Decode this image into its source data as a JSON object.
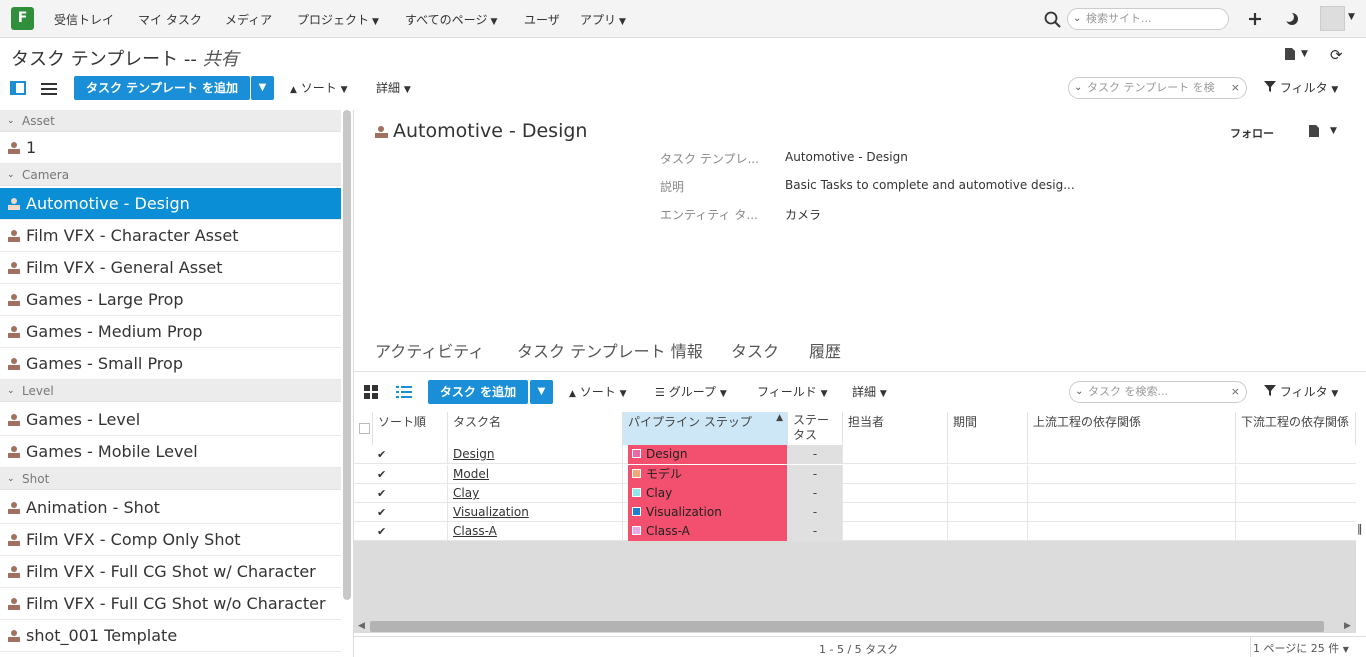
{
  "nav": {
    "logo": "F",
    "inbox": "受信トレイ",
    "my_tasks": "マイ タスク",
    "media": "メディア",
    "projects": "プロジェクト",
    "all_pages": "すべてのページ",
    "users": "ユーザ",
    "apps": "アプリ",
    "search_placeholder": "検索サイト..."
  },
  "page": {
    "title": "タスク テンプレート -- ",
    "title_suffix": "共有",
    "add_template_button": "タスク テンプレート を追加",
    "sort_label": "ソート",
    "detail_label": "詳細",
    "search_placeholder": "タスク テンプレート を検",
    "filter_label": "フィルタ"
  },
  "sidebar": {
    "groups": [
      {
        "label": "Asset",
        "items": [
          "1"
        ]
      },
      {
        "label": "Camera",
        "items": [
          "Automotive - Design",
          "Film VFX - Character Asset",
          "Film VFX - General Asset",
          "Games - Large Prop",
          "Games - Medium Prop",
          "Games - Small Prop"
        ]
      },
      {
        "label": "Level",
        "items": [
          "Games - Level",
          "Games - Mobile Level"
        ]
      },
      {
        "label": "Shot",
        "items": [
          "Animation - Shot",
          "Film VFX - Comp Only Shot",
          "Film VFX - Full CG Shot w/ Character",
          "Film VFX - Full CG Shot w/o Character",
          "shot_001 Template"
        ]
      }
    ],
    "selected": "Automotive - Design"
  },
  "detail": {
    "title": "Automotive - Design",
    "follow": "フォロー",
    "fields": [
      {
        "label": "タスク テンプレ...",
        "value": "Automotive - Design"
      },
      {
        "label": "説明",
        "value": "Basic Tasks to complete and automotive desig..."
      },
      {
        "label": "エンティティ タ...",
        "value": "カメラ"
      }
    ],
    "tabs": [
      "アクティビティ",
      "タスク テンプレート 情報",
      "タスク",
      "履歴"
    ]
  },
  "tasks_toolbar": {
    "add_task_button": "タスク を追加",
    "sort": "ソート",
    "group": "グループ",
    "fields": "フィールド",
    "detail": "詳細",
    "search_placeholder": "タスク を検索...",
    "filter": "フィルタ"
  },
  "grid": {
    "columns": [
      "ソート順",
      "タスク名",
      "パイプライン ステップ",
      "ステータス",
      "担当者",
      "期間",
      "上流工程の依存関係",
      "下流工程の依存関係"
    ],
    "rows": [
      {
        "name": "Design",
        "step": "Design",
        "step_color": "#e86aa6",
        "status": "-"
      },
      {
        "name": "Model",
        "step": "モデル",
        "step_color": "#f0a878",
        "status": "-"
      },
      {
        "name": "Clay",
        "step": "Clay",
        "step_color": "#8fe8e8",
        "status": "-"
      },
      {
        "name": "Visualization",
        "step": "Visualization",
        "step_color": "#1a7fd0",
        "status": "-"
      },
      {
        "name": "Class-A",
        "step": "Class-A",
        "step_color": "#e8a8e0",
        "status": "-"
      }
    ],
    "footer_count": "1 - 5 / 5 タスク",
    "per_page": "1 ページに 25 件"
  },
  "colors": {
    "accent": "#1a8fd8",
    "selected_row": "#0a8ed6",
    "pipeline_bg": "#f2506e"
  }
}
